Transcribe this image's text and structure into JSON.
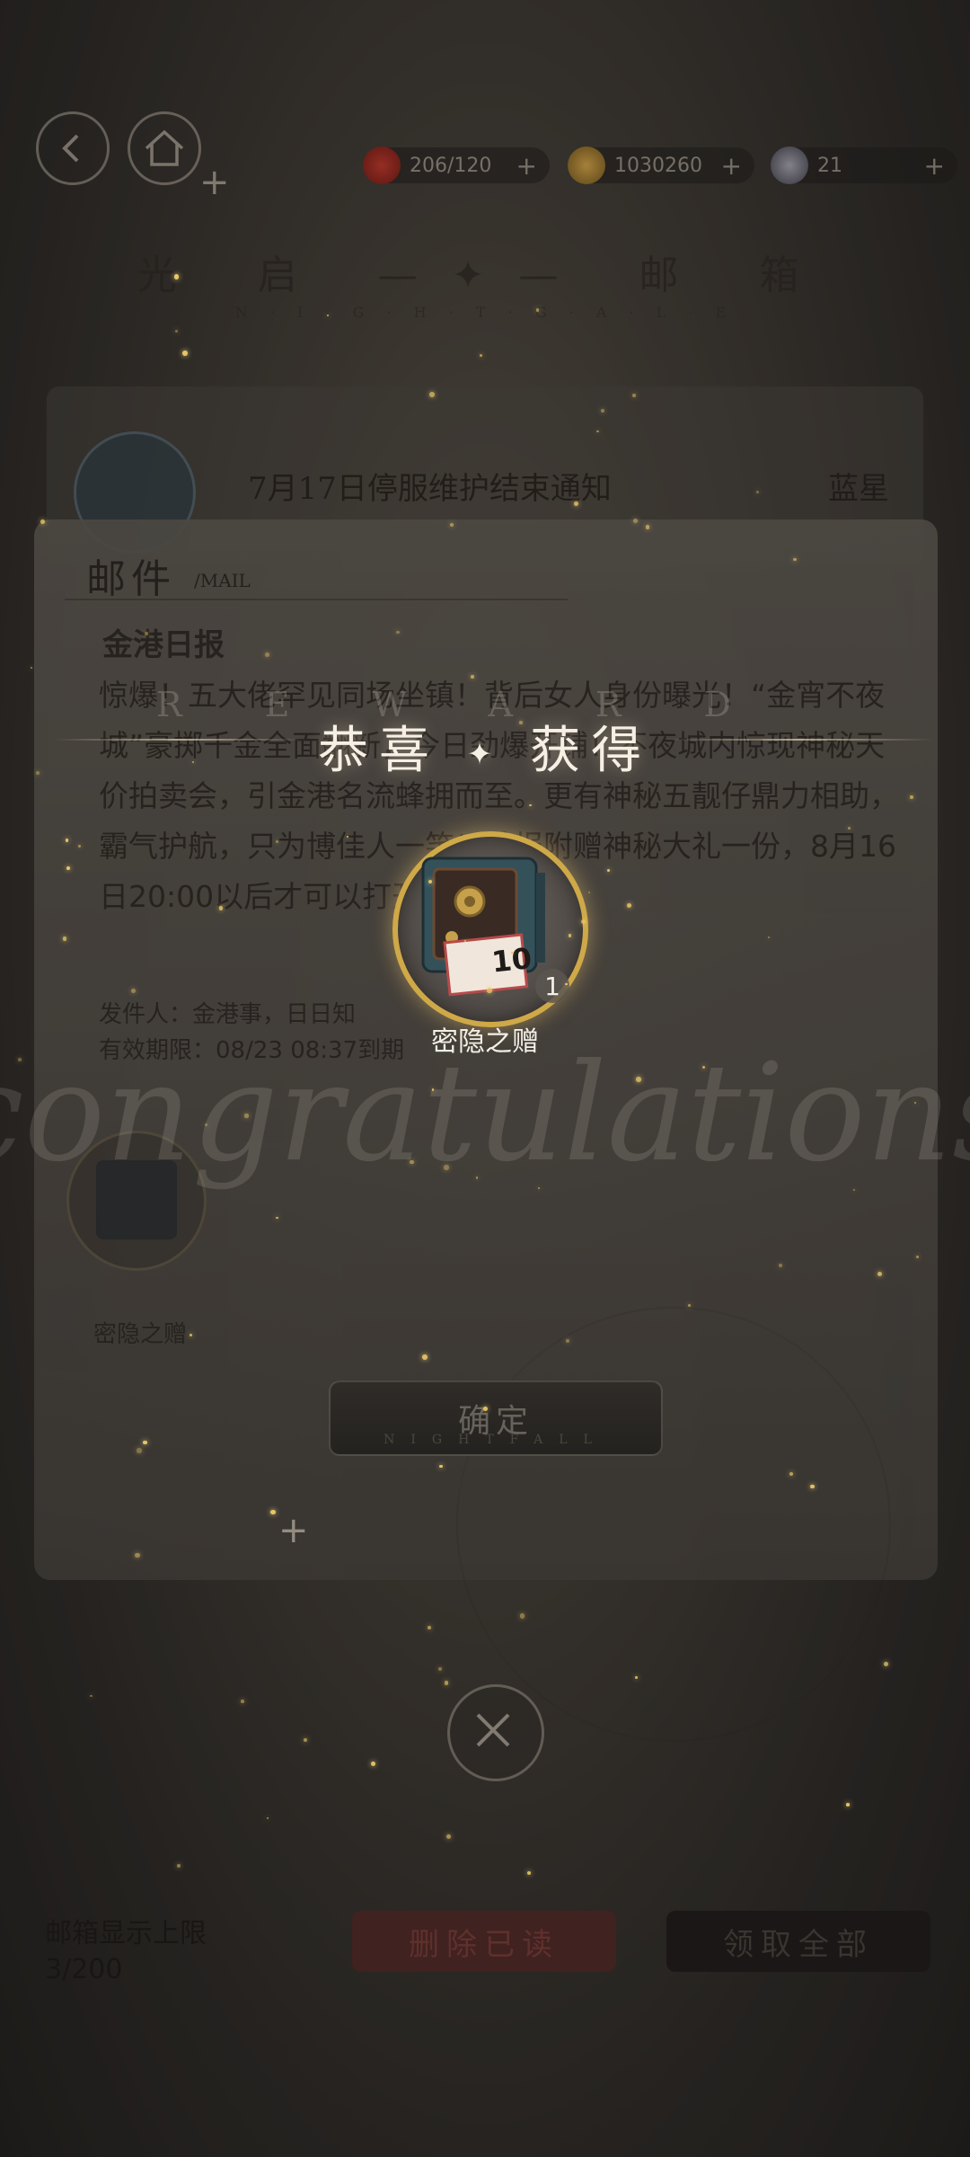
{
  "topbar": {
    "currencies": [
      {
        "icon": "apple-icon",
        "value": "206/120"
      },
      {
        "icon": "coin-icon",
        "value": "1030260"
      },
      {
        "icon": "diamond-icon",
        "value": "21"
      }
    ]
  },
  "mailbox": {
    "title": "光 启 —✦— 邮 箱",
    "subtitle": "N · I · G · H · T · G · A · L · E"
  },
  "mail_list": {
    "item_title": "7月17日停服维护结束通知",
    "item_sender": "蓝星"
  },
  "mail_panel": {
    "header": "邮件",
    "header_en": "/MAIL",
    "title": "金港日报",
    "body": "惊爆！五大佬罕见同场坐镇！背后女人身份曝光！“金宵不夜城”豪掷千金全面翻新，今日劲爆开铺！不夜城内惊现神秘天价拍卖会，引金港名流蜂拥而至。更有神秘五靓仔鼎力相助，霸气护航，只为博佳人一笑！随报附赠神秘大礼一份，8月16日20:00以后才可以打开哦。",
    "sender": "发件人：金港事，日日知",
    "expiry": "有效期限：08/23 08:37到期",
    "attachment_name": "密隐之赠"
  },
  "popup": {
    "deco_letters": "REWARD",
    "headline_left": "恭喜",
    "headline_right": "获得",
    "item_name": "密隐之赠",
    "item_count": "1",
    "confirm_label": "确定",
    "confirm_sub": "NIGHTFALL",
    "watermark": "congratulations"
  },
  "bottom": {
    "limit_label": "邮箱显示上限",
    "limit_value": "3/200",
    "delete_read": "删除已读",
    "claim_all": "领取全部"
  },
  "colors": {
    "gold": "#cfa948",
    "headline": "#f5efe4",
    "delete_button": "#5a2d2b",
    "claim_button": "#1e1c1a"
  }
}
